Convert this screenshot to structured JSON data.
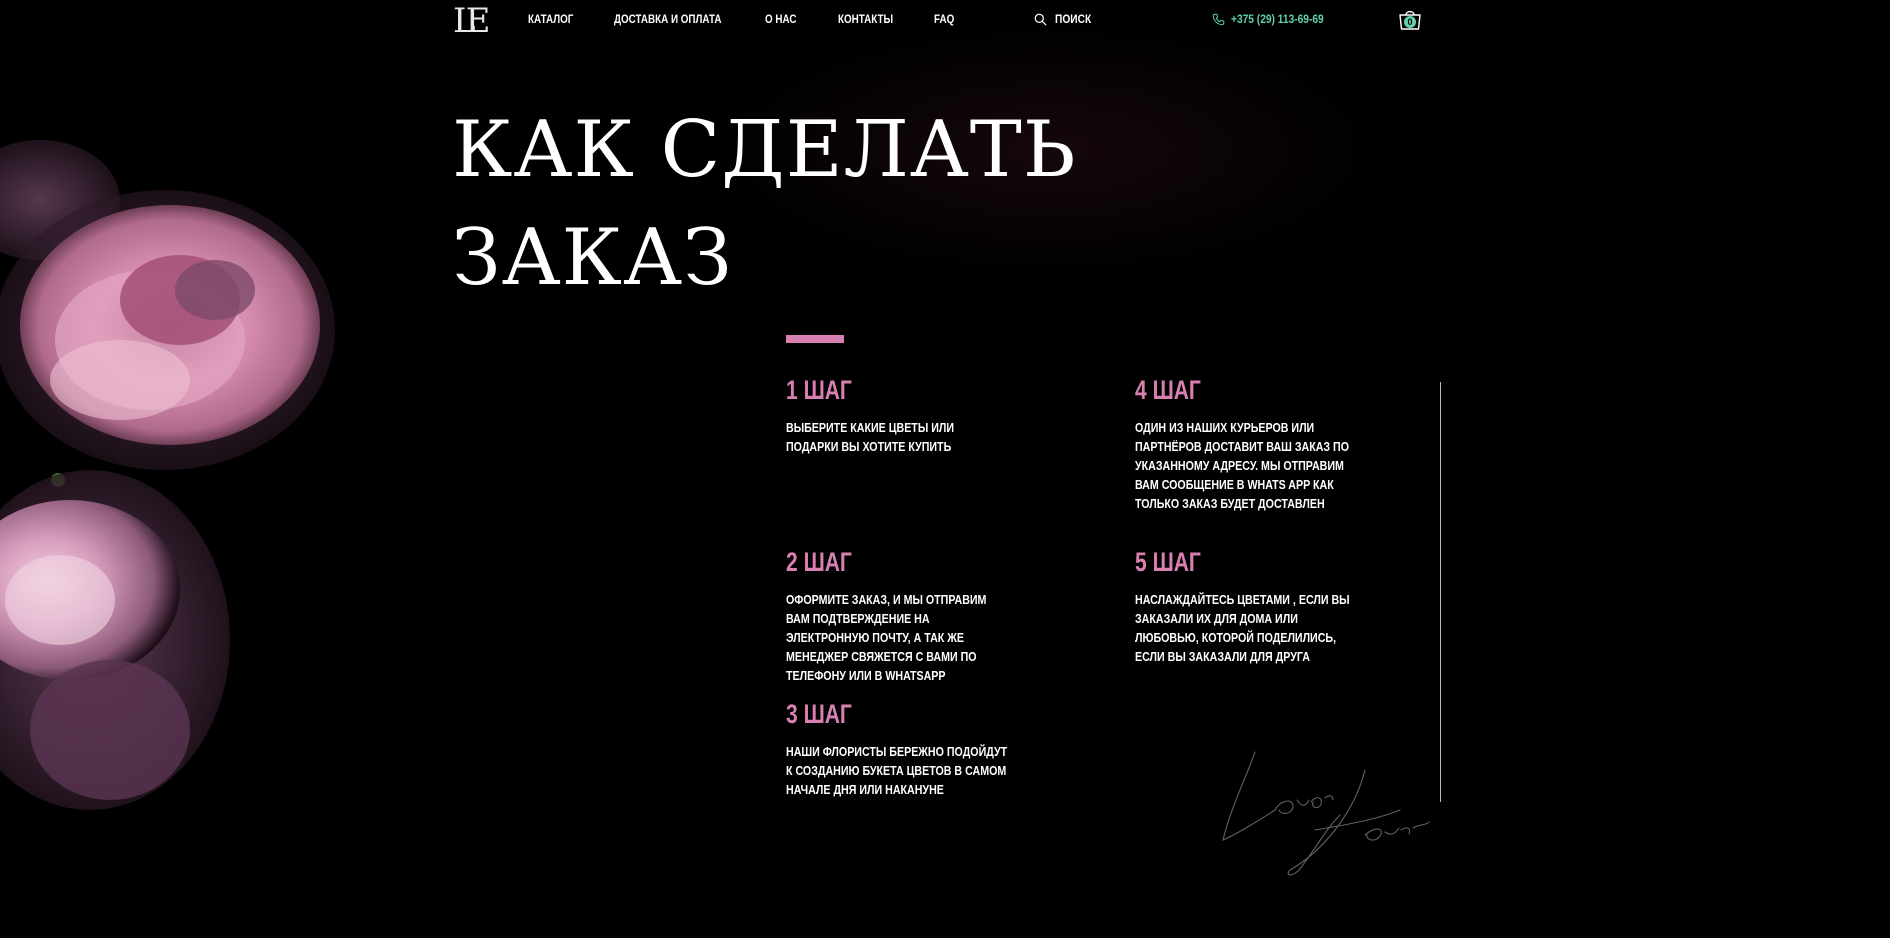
{
  "header": {
    "logo": "LE",
    "nav": [
      {
        "label": "КАТАЛОГ"
      },
      {
        "label": "ДОСТАВКА И ОПЛАТА"
      },
      {
        "label": "О НАС"
      },
      {
        "label": "КОНТАКТЫ"
      },
      {
        "label": "FAQ"
      }
    ],
    "search_label": "ПОИСК",
    "phone": "+375 (29) 113-69-69",
    "cart_count": "0"
  },
  "hero": {
    "title_line1": "КАК СДЕЛАТЬ",
    "title_line2": "ЗАКАЗ"
  },
  "steps": [
    {
      "title": "1 ШАГ",
      "text": "ВЫБЕРИТЕ КАКИЕ ЦВЕТЫ ИЛИ ПОДАРКИ ВЫ ХОТИТЕ КУПИТЬ"
    },
    {
      "title": "2 ШАГ",
      "text": "ОФОРМИТЕ ЗАКАЗ, И МЫ ОТПРАВИМ ВАМ ПОДТВЕРЖДЕНИЕ НА ЭЛЕКТРОННУЮ ПОЧТУ, А ТАК ЖЕ МЕНЕДЖЕР СВЯЖЕТСЯ С ВАМИ ПО ТЕЛЕФОНУ ИЛИ В WHATSAPP"
    },
    {
      "title": "3 ШАГ",
      "text": "НАШИ ФЛОРИСТЫ БЕРЕЖНО ПОДОЙДУТ К СОЗДАНИЮ БУКЕТА ЦВЕТОВ В САМОМ НАЧАЛЕ ДНЯ ИЛИ НАКАНУНЕ"
    },
    {
      "title": "4 ШАГ",
      "text": "ОДИН ИЗ НАШИХ КУРЬЕРОВ ИЛИ ПАРТНЁРОВ ДОСТАВИТ ВАШ ЗАКАЗ ПО УКАЗАННОМУ АДРЕСУ. МЫ ОТПРАВИМ ВАМ СООБЩЕНИЕ В WHATS APP КАК ТОЛЬКО ЗАКАЗ БУДЕТ ДОСТАВЛЕН"
    },
    {
      "title": "5 ШАГ",
      "text": "НАСЛАЖДАЙТЕСЬ ЦВЕТАМИ , ЕСЛИ ВЫ ЗАКАЗАЛИ ИХ ДЛЯ ДОМА ИЛИ ЛЮБОВЬЮ, КОТОРОЙ ПОДЕЛИЛИСЬ, ЕСЛИ ВЫ ЗАКАЗАЛИ ДЛЯ ДРУГА"
    }
  ],
  "signature_text": "Lover Flower",
  "colors": {
    "accent_pink": "#d980b2",
    "phone_green": "#5fd3a6",
    "background": "#000000"
  },
  "icons": {
    "search": "search-icon",
    "phone": "phone-icon",
    "cart": "shopping-bag-icon"
  }
}
